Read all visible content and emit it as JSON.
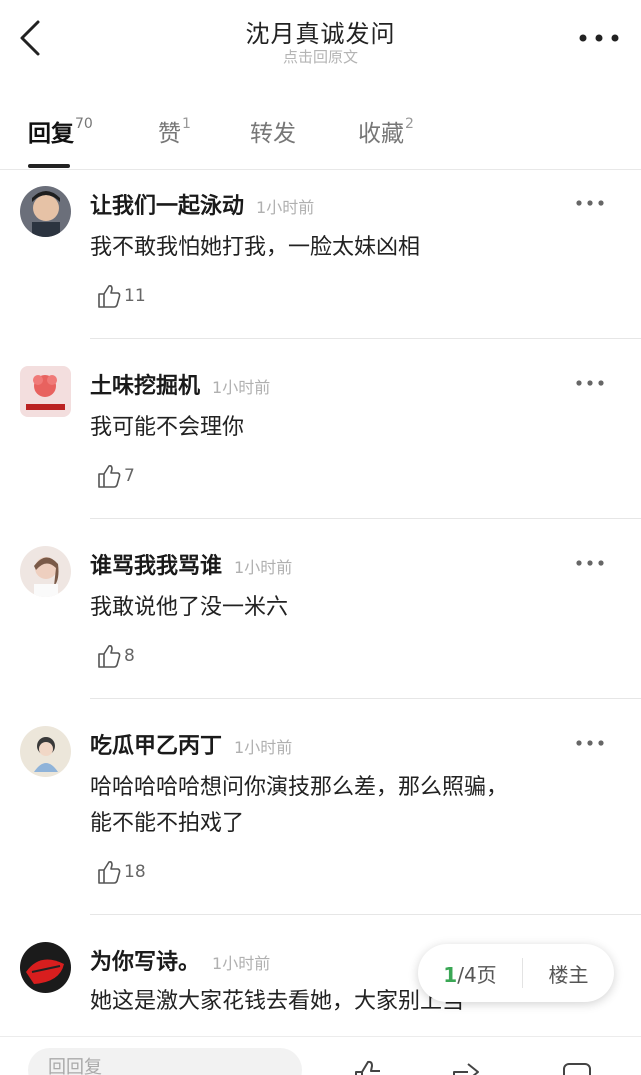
{
  "header": {
    "title": "沈月真诚发问",
    "subtitle": "点击回原文"
  },
  "tabs": [
    {
      "label": "回复",
      "count": "70"
    },
    {
      "label": "赞",
      "count": "1"
    },
    {
      "label": "转发",
      "count": ""
    },
    {
      "label": "收藏",
      "count": "2"
    }
  ],
  "comments": [
    {
      "user": "让我们一起泳动",
      "time": "1小时前",
      "lines": [
        "我不敢我怕她打我，一脸太妹凶相"
      ],
      "likes": "11"
    },
    {
      "user": "土味挖掘机",
      "time": "1小时前",
      "lines": [
        "我可能不会理你"
      ],
      "likes": "7"
    },
    {
      "user": "谁骂我我骂谁",
      "time": "1小时前",
      "lines": [
        "我敢说他了没一米六"
      ],
      "likes": "8"
    },
    {
      "user": "吃瓜甲乙丙丁",
      "time": "1小时前",
      "lines": [
        "哈哈哈哈哈想问你演技那么差，那么照骗，",
        "能不能不拍戏了"
      ],
      "likes": "18"
    },
    {
      "user": "为你写诗。",
      "time": "1小时前",
      "lines": [
        "她这是激大家花钱去看她，大家别上当"
      ],
      "likes": ""
    }
  ],
  "pager": {
    "current": "1",
    "rest": "/4页",
    "op_label": "楼主"
  },
  "bottom": {
    "reply_placeholder": "回回复"
  },
  "colors": {
    "accent_green": "#3aa755",
    "divider": "#e6e6e6"
  }
}
